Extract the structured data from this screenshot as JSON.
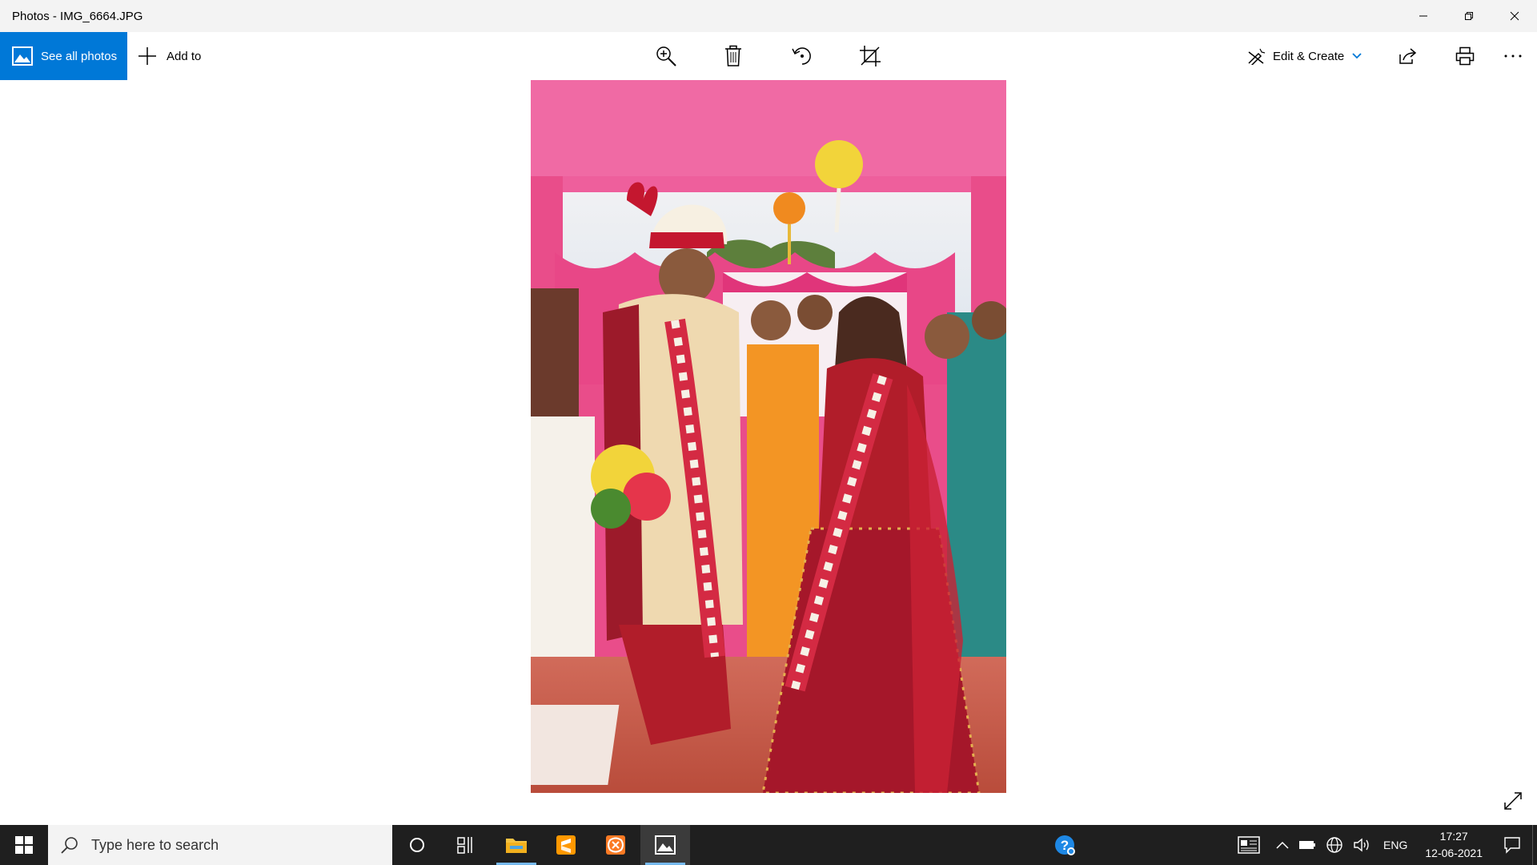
{
  "window": {
    "title": "Photos - IMG_6664.JPG"
  },
  "toolbar": {
    "see_all_photos": "See all photos",
    "add_to": "Add to",
    "edit_create": "Edit & Create"
  },
  "taskbar": {
    "search_placeholder": "Type here to search",
    "language": "ENG",
    "time": "17:27",
    "date": "12-06-2021"
  },
  "colors": {
    "accent": "#0078d7",
    "taskbar": "#1f1f1f",
    "titlebar": "#f3f3f3"
  },
  "icons": [
    "windows-start-icon",
    "search-icon",
    "cortana-icon",
    "task-view-icon",
    "file-explorer-icon",
    "sublime-text-icon",
    "xampp-icon",
    "photos-icon",
    "help-icon",
    "news-icon",
    "chevron-up-icon",
    "battery-icon",
    "network-icon",
    "volume-icon",
    "notification-icon",
    "zoom-in-icon",
    "delete-icon",
    "rotate-icon",
    "crop-icon",
    "share-icon",
    "print-icon",
    "more-icon",
    "expand-icon"
  ]
}
